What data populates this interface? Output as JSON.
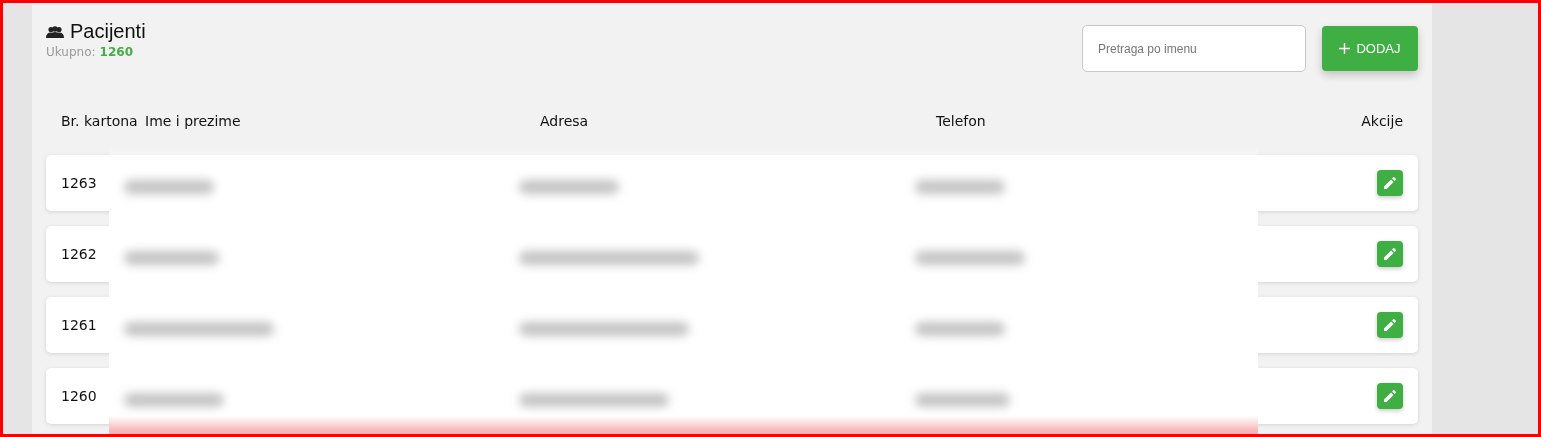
{
  "header": {
    "title": "Pacijenti",
    "total_label": "Ukupno:",
    "total_value": "1260"
  },
  "search": {
    "placeholder": "Pretraga po imenu"
  },
  "add_button": {
    "label": "DODAJ"
  },
  "table": {
    "columns": [
      "Br. kartona",
      "Ime i prezime",
      "Adresa",
      "Telefon",
      "Akcije"
    ],
    "rows": [
      {
        "card_number": "1263"
      },
      {
        "card_number": "1262"
      },
      {
        "card_number": "1261"
      },
      {
        "card_number": "1260"
      }
    ]
  }
}
